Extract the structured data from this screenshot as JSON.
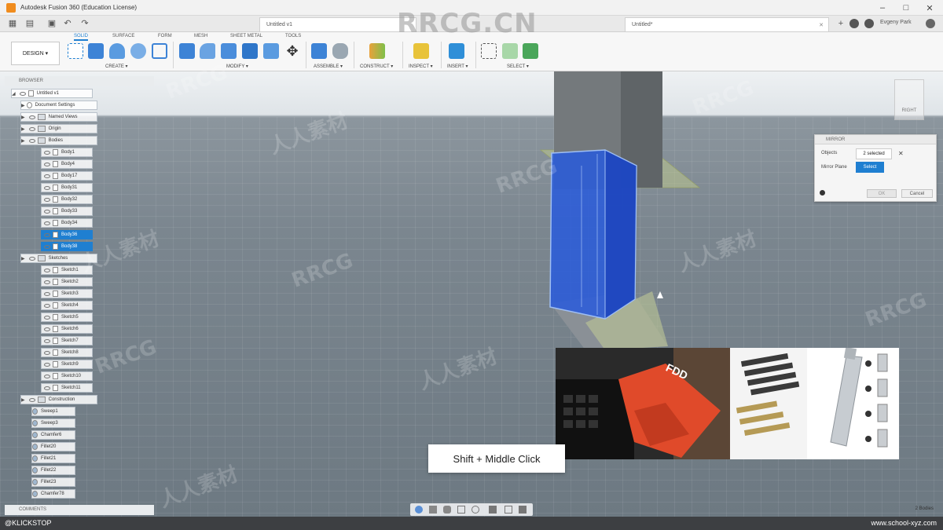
{
  "window": {
    "title": "Autodesk Fusion 360 (Education License)",
    "minimize": "–",
    "maximize": "□",
    "close": "✕"
  },
  "tabs": {
    "doc_tab_1": "Untitled v1",
    "doc_tab_2": "Untitled*",
    "user": "Evgeny Park"
  },
  "toolbar": {
    "workspace_tabs": [
      "SOLID",
      "SURFACE",
      "FORM",
      "MESH",
      "SHEET METAL",
      "TOOLS"
    ],
    "design_button": "DESIGN ▾",
    "groups": [
      "CREATE ▾",
      "MODIFY ▾",
      "ASSEMBLE ▾",
      "CONSTRUCT ▾",
      "INSPECT ▾",
      "INSERT ▾",
      "SELECT ▾"
    ],
    "accent_color": "#1f7fd1"
  },
  "browser": {
    "header": "BROWSER",
    "root": "Untitled v1",
    "items": [
      {
        "label": "Document Settings",
        "level": 1,
        "type": "settings"
      },
      {
        "label": "Named Views",
        "level": 1,
        "type": "folder"
      },
      {
        "label": "Origin",
        "level": 1,
        "type": "folder"
      },
      {
        "label": "Bodies",
        "level": 1,
        "type": "folder"
      },
      {
        "label": "Body1",
        "level": 2,
        "type": "body"
      },
      {
        "label": "Body4",
        "level": 2,
        "type": "body"
      },
      {
        "label": "Body17",
        "level": 2,
        "type": "body"
      },
      {
        "label": "Body31",
        "level": 2,
        "type": "body"
      },
      {
        "label": "Body32",
        "level": 2,
        "type": "body"
      },
      {
        "label": "Body33",
        "level": 2,
        "type": "body"
      },
      {
        "label": "Body34",
        "level": 2,
        "type": "body"
      },
      {
        "label": "Body36",
        "level": 2,
        "type": "body",
        "selected": true
      },
      {
        "label": "Body38",
        "level": 2,
        "type": "body",
        "selected": true
      },
      {
        "label": "Sketches",
        "level": 1,
        "type": "folder"
      },
      {
        "label": "Sketch1",
        "level": 2,
        "type": "sketch"
      },
      {
        "label": "Sketch2",
        "level": 2,
        "type": "sketch"
      },
      {
        "label": "Sketch3",
        "level": 2,
        "type": "sketch"
      },
      {
        "label": "Sketch4",
        "level": 2,
        "type": "sketch"
      },
      {
        "label": "Sketch5",
        "level": 2,
        "type": "sketch"
      },
      {
        "label": "Sketch6",
        "level": 2,
        "type": "sketch"
      },
      {
        "label": "Sketch7",
        "level": 2,
        "type": "sketch"
      },
      {
        "label": "Sketch8",
        "level": 2,
        "type": "sketch"
      },
      {
        "label": "Sketch9",
        "level": 2,
        "type": "sketch"
      },
      {
        "label": "Sketch10",
        "level": 2,
        "type": "sketch"
      },
      {
        "label": "Sketch11",
        "level": 2,
        "type": "sketch"
      },
      {
        "label": "Construction",
        "level": 1,
        "type": "folder"
      },
      {
        "label": "Sweep1",
        "level": 1,
        "type": "feature"
      },
      {
        "label": "Sweep3",
        "level": 1,
        "type": "feature"
      },
      {
        "label": "Chamfer6",
        "level": 1,
        "type": "feature"
      },
      {
        "label": "Fillet20",
        "level": 1,
        "type": "feature"
      },
      {
        "label": "Fillet21",
        "level": 1,
        "type": "feature"
      },
      {
        "label": "Fillet22",
        "level": 1,
        "type": "feature"
      },
      {
        "label": "Fillet23",
        "level": 1,
        "type": "feature"
      },
      {
        "label": "Chamfer78",
        "level": 1,
        "type": "feature"
      }
    ],
    "comments": "COMMENTS"
  },
  "mirror_dialog": {
    "title": "MIRROR",
    "objects_label": "Objects",
    "objects_value": "2 selected",
    "plane_label": "Mirror Plane",
    "plane_button": "Select",
    "ok": "OK",
    "cancel": "Cancel"
  },
  "viewcube": {
    "label": "RIGHT"
  },
  "overlay": {
    "tooltip": "Shift + Middle Click",
    "fdd_label": "FDD"
  },
  "watermark": {
    "main": "RRCG.CN",
    "small": "RRCG",
    "cn": "人人素材"
  },
  "status": {
    "left": "@KLICKSTOP",
    "right": "www.school-xyz.com",
    "bodies": "2 Bodies"
  }
}
